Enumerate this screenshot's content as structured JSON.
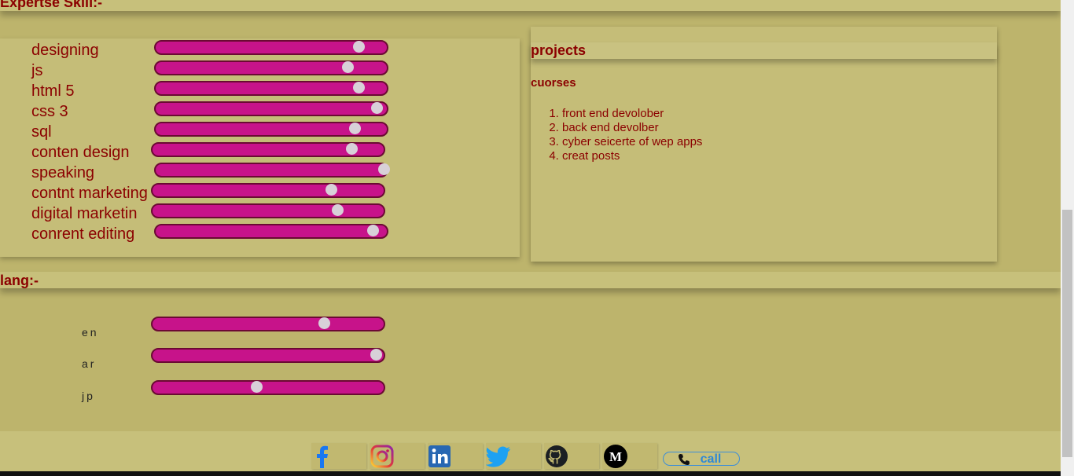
{
  "headers": {
    "expertise": "Expertse Skill:-",
    "lang": "lang:-"
  },
  "skills": [
    {
      "label": "designing",
      "level": 0.89
    },
    {
      "label": "js",
      "level": 0.84
    },
    {
      "label": "html 5",
      "level": 0.89
    },
    {
      "label": "css 3",
      "level": 0.97
    },
    {
      "label": "sql",
      "level": 0.87
    },
    {
      "label": "conten design",
      "level": 0.87
    },
    {
      "label": "speaking",
      "level": 1.0
    },
    {
      "label": "contnt marketing",
      "level": 0.78
    },
    {
      "label": "digital marketin",
      "level": 0.81
    },
    {
      "label": "conrent editing",
      "level": 0.95
    }
  ],
  "projects": {
    "title": "projects",
    "courses_title": "cuorses",
    "courses": [
      "front end devolober",
      "back end devolber",
      "cyber seicerte of wep apps",
      "creat posts"
    ]
  },
  "langs": [
    {
      "label": "en",
      "level": 0.75
    },
    {
      "label": "ar",
      "level": 0.98
    },
    {
      "label": "jp",
      "level": 0.45
    }
  ],
  "footer": {
    "social_icons": [
      "facebook-icon",
      "instagram-icon",
      "linkedin-icon",
      "twitter-icon",
      "github-icon",
      "medium-icon"
    ],
    "call_label": "call"
  },
  "colors": {
    "background": "#bdb46c",
    "header_text": "#8b0000",
    "bar_fill": "#c7138a",
    "thumb": "#d8d0d8",
    "call_link": "#2e88d6"
  }
}
